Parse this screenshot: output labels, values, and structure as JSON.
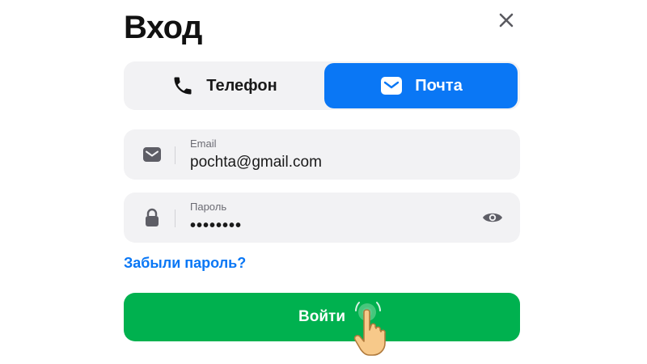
{
  "header": {
    "title": "Вход",
    "close_icon": "close-icon"
  },
  "tabs": [
    {
      "label": "Телефон",
      "icon": "phone-icon",
      "active": false
    },
    {
      "label": "Почта",
      "icon": "envelope-icon",
      "active": true
    }
  ],
  "form": {
    "email": {
      "label": "Email",
      "value": "pochta@gmail.com",
      "icon": "envelope-icon"
    },
    "password": {
      "label": "Пароль",
      "value": "••••••••",
      "icon": "lock-icon",
      "toggle_icon": "eye-icon"
    },
    "forgot_link": "Забыли пароль?",
    "submit_label": "Войти"
  },
  "colors": {
    "accent_blue": "#0a77f5",
    "submit_green": "#00b14f",
    "field_bg": "#f2f2f4"
  }
}
